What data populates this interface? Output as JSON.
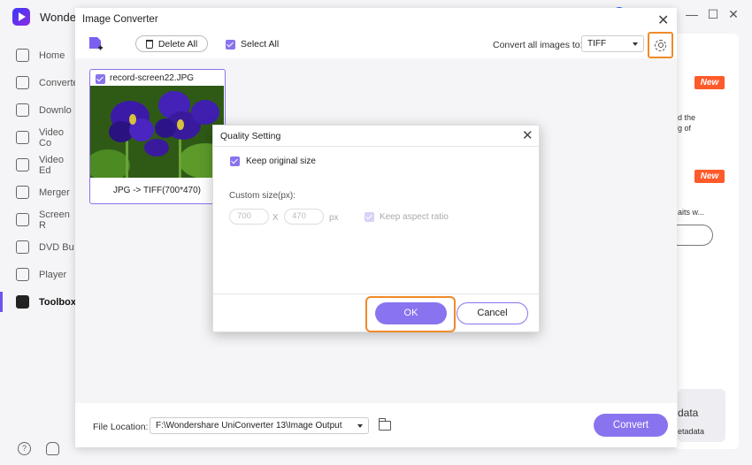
{
  "app": {
    "name": "Wonder",
    "sidebar": [
      {
        "label": "Home",
        "icon": "home-icon"
      },
      {
        "label": "Converte",
        "icon": "converter-icon"
      },
      {
        "label": "Downlo",
        "icon": "download-icon"
      },
      {
        "label": "Video Co",
        "icon": "video-compress-icon"
      },
      {
        "label": "Video Ed",
        "icon": "video-edit-icon"
      },
      {
        "label": "Merger",
        "icon": "merger-icon"
      },
      {
        "label": "Screen R",
        "icon": "screen-record-icon"
      },
      {
        "label": "DVD Bu",
        "icon": "dvd-icon"
      },
      {
        "label": "Player",
        "icon": "player-icon"
      },
      {
        "label": "Toolbox",
        "icon": "toolbox-icon",
        "active": true
      }
    ],
    "right_panel": {
      "badge_new": "New",
      "text_1": "d the\ng of",
      "text_2": "aits w...",
      "text_3": "data",
      "text_4": "etadata"
    }
  },
  "image_converter": {
    "title": "Image Converter",
    "delete_all_label": "Delete All",
    "select_all_label": "Select All",
    "convert_all_label": "Convert all images to:",
    "format_value": "TIFF",
    "file": {
      "name": "record-screen22.JPG",
      "caption": "JPG -> TIFF(700*470)"
    },
    "file_location_label": "File Location:",
    "file_location_value": "F:\\Wondershare UniConverter 13\\Image Output",
    "convert_label": "Convert"
  },
  "quality_setting": {
    "title": "Quality Setting",
    "keep_original_label": "Keep original size",
    "custom_size_label": "Custom size(px):",
    "width_value": "700",
    "x_label": "X",
    "height_value": "470",
    "px_label": "px",
    "keep_aspect_label": "Keep aspect ratio",
    "ok_label": "OK",
    "cancel_label": "Cancel"
  },
  "colors": {
    "accent": "#8a73ef",
    "highlight": "#f08a2a",
    "new_badge": "#ff5a2a"
  }
}
